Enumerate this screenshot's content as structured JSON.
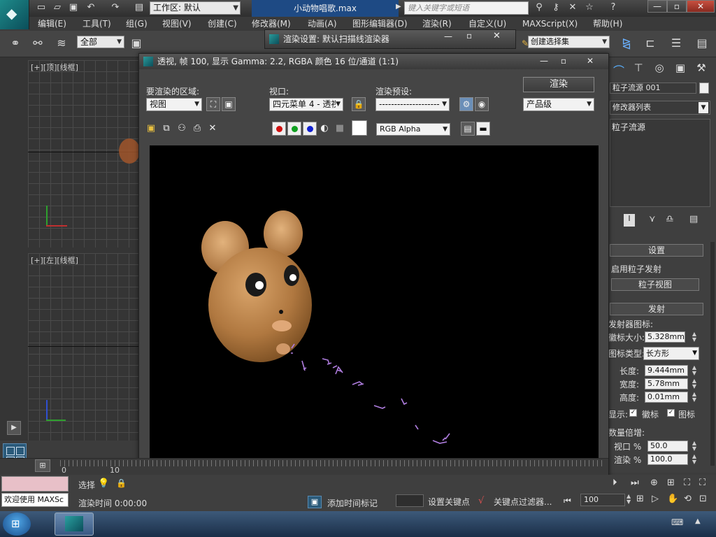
{
  "app": {
    "workspace_label": "工作区: 默认",
    "doc_title": "小动物唱歌.max",
    "search_placeholder": "键入关键字或短语"
  },
  "menu": [
    "编辑(E)",
    "工具(T)",
    "组(G)",
    "视图(V)",
    "创建(C)",
    "修改器(M)",
    "动画(A)",
    "图形编辑器(D)",
    "渲染(R)",
    "自定义(U)",
    "MAXScript(X)",
    "帮助(H)"
  ],
  "toolbar": {
    "selection_filter": "全部",
    "selection_set": "创建选择集"
  },
  "viewports": {
    "top_label": "[+][顶][线框]",
    "left_label": "[+][左][线框]"
  },
  "render_setup": {
    "title": "渲染设置: 默认扫描线渲染器"
  },
  "frame_window": {
    "title": "透视, 帧 100, 显示 Gamma: 2.2, RGBA 颜色 16 位/通道 (1:1)",
    "area_label": "要渲染的区域:",
    "area_value": "视图",
    "viewport_label": "视口:",
    "viewport_value": "四元菜单 4 - 透视",
    "preset_label": "渲染预设:",
    "preset_value": "--------------------",
    "render_button": "渲染",
    "quality_value": "产品级",
    "channel_value": "RGB Alpha"
  },
  "command_panel": {
    "object_name": "粒子流源 001",
    "modifier_list": "修改器列表",
    "stack_item": "粒子流源",
    "rollout_setup": "设置",
    "enable_emission": "启用粒子发射",
    "particle_view": "粒子视图",
    "rollout_emission": "发射",
    "emitter_icon": "发射器图标:",
    "logo_size_label": "徽标大小:",
    "logo_size_value": "5.328mm",
    "icon_type_label": "图标类型:",
    "icon_type_value": "长方形",
    "length_label": "长度:",
    "length_value": "9.444mm",
    "width_label": "宽度:",
    "width_value": "5.78mm",
    "height_label": "高度:",
    "height_value": "0.01mm",
    "show_label": "显示:",
    "show_logo": "徽标",
    "show_icon": "图标",
    "qty_multiplier": "数量倍增:",
    "viewport_pct_label": "视口 %",
    "viewport_pct_value": "50.0",
    "render_pct_label": "渲染 %",
    "render_pct_value": "100.0"
  },
  "timeline": {
    "tick_0": "0",
    "tick_10": "10"
  },
  "status": {
    "welcome": "欢迎使用 MAXSc",
    "select_label": "选择",
    "render_time": "渲染时间  0:00:00",
    "add_time_tag": "添加时间标记",
    "set_key": "设置关键点",
    "key_filters": "关键点过滤器...",
    "frame_value": "100"
  },
  "colors": {
    "accent": "#1e4a84",
    "panel": "#454545",
    "mouse": "#b07840"
  }
}
